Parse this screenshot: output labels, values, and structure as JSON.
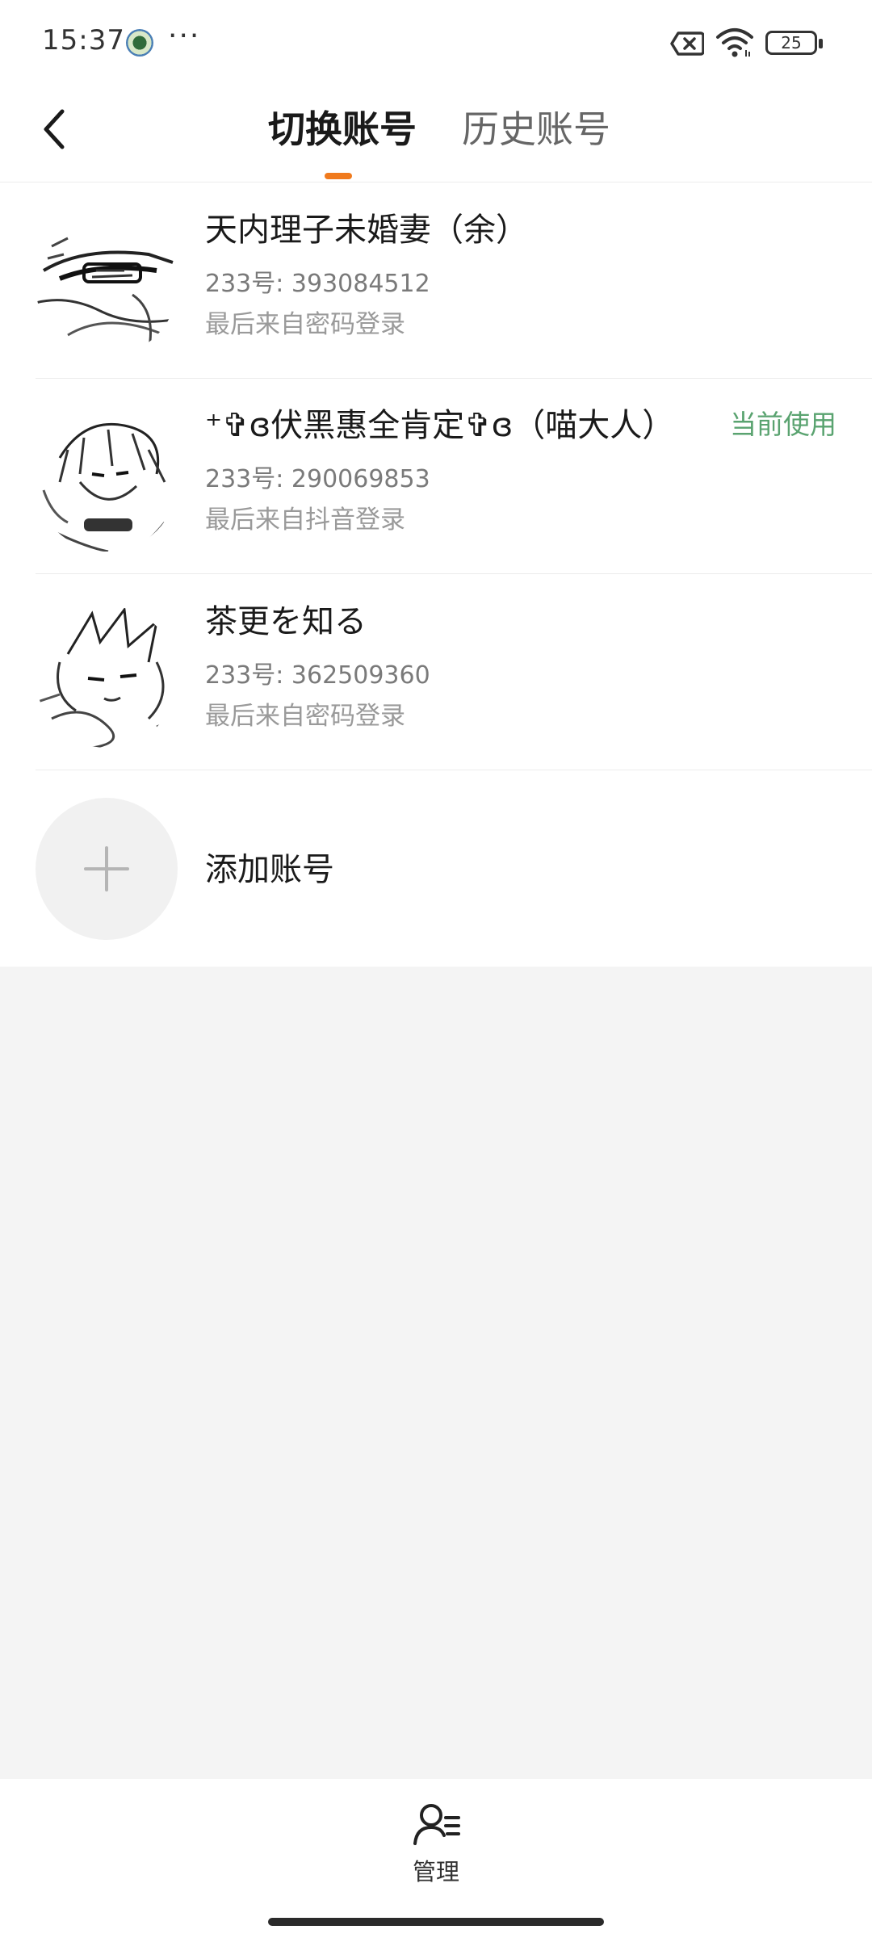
{
  "status_bar": {
    "time": "15:37",
    "more": "···",
    "battery": "25",
    "icons": [
      "app-notification-icon",
      "sim-error-icon",
      "wifi-icon",
      "battery-icon"
    ]
  },
  "header": {
    "back_icon": "chevron-left-icon",
    "tabs": [
      {
        "label": "切换账号",
        "active": true
      },
      {
        "label": "历史账号",
        "active": false
      }
    ],
    "accent_color": "#f07a1d"
  },
  "accounts": [
    {
      "name": "天内理子未婚妻（余）",
      "id_text": "233号: 393084512",
      "login_text": "最后来自密码登录",
      "current": false
    },
    {
      "name": "⁺✞ɞ伏黑惠全肯定✞ɞ（喵大人）",
      "id_text": "233号: 290069853",
      "login_text": "最后来自抖音登录",
      "current": true,
      "current_label": "当前使用"
    },
    {
      "name": "茶更を知る",
      "id_text": "233号: 362509360",
      "login_text": "最后来自密码登录",
      "current": false
    }
  ],
  "add_account": {
    "label": "添加账号",
    "icon": "plus-icon"
  },
  "bottom_bar": {
    "manage_label": "管理",
    "manage_icon": "user-manage-icon"
  },
  "colors": {
    "current_green": "#5aa370",
    "background": "#f4f4f4"
  }
}
